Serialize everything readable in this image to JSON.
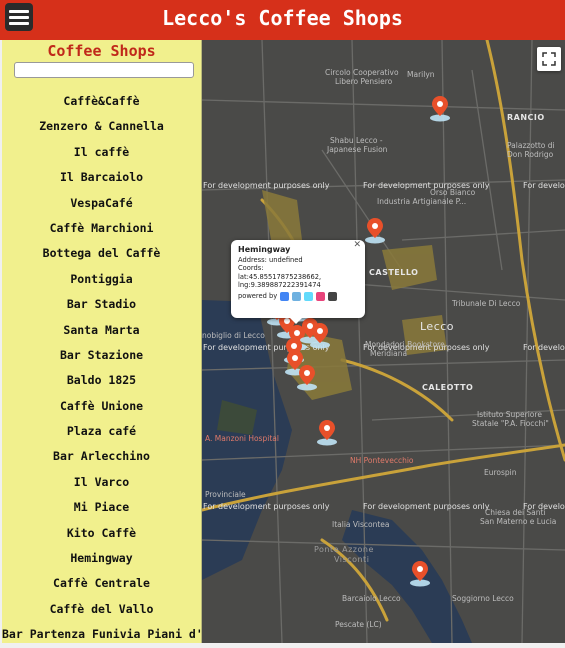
{
  "header": {
    "title": "Lecco's Coffee Shops"
  },
  "sidebar": {
    "heading": "Coffee Shops",
    "search": {
      "value": "",
      "placeholder": ""
    },
    "shops": [
      "Caffè&Caffè",
      "Zenzero & Cannella",
      "Il caffè",
      "Il Barcaiolo",
      "VespaCafé",
      "Caffè Marchioni",
      "Bottega del Caffè",
      "Pontiggia",
      "Bar Stadio",
      "Santa Marta",
      "Bar Stazione",
      "Baldo 1825",
      "Caffè Unione",
      "Plaza café",
      "Bar Arlecchino",
      "Il Varco",
      "Mi Piace",
      "Kito Caffè",
      "Hemingway",
      "Caffè Centrale",
      "Caffè del Vallo",
      "Bar Partenza Funivia Piani d'Erna"
    ]
  },
  "map": {
    "watermark": "For development purposes only",
    "labels": {
      "circolo": "Circolo Cooperativo",
      "circolo2": "Libero Pensiero",
      "marilyn": "Marilyn",
      "rancio": "RANCIO",
      "shabu": "Shabu Lecco -",
      "shabu2": "Japanese Fusion",
      "palazzotto": "Palazzotto di",
      "palazzotto2": "Don Rodrigo",
      "orso": "Orso Bianco",
      "orso2": "Industria Artigianale P...",
      "castello": "CASTELLO",
      "lecco": "Lecco",
      "tribunale": "Tribunale Di Lecco",
      "mondadori": "Mondadori Bookstore",
      "meridiana": "Meridiana",
      "caleotto": "CALEOTTO",
      "istituto": "Istituto Superiore",
      "istituto2": "Statale \"P.A. Fiocchi\"",
      "manzoni": "A. Manzoni Hospital",
      "nh": "NH Pontevecchio",
      "eurospin": "Eurospin",
      "provinciale": "Provinciale",
      "visconte": "Italia Viscontea",
      "ponte": "Ponte Azzone",
      "ponte2": "Visconti",
      "chiesa": "Chiesa dei Santi",
      "chiesa2": "San Materno e Lucia",
      "soggiorno": "Soggiorno Lecco",
      "barcaiolo": "Barcaiolo Lecco",
      "pescate": "Pescate (LC)",
      "nobiglio": "nobiglio di Lecco"
    },
    "colors": {
      "pin": "#e8502a",
      "road_major": "#c9a23a",
      "road": "#6b6b68",
      "water": "#2b3c55"
    },
    "popup": {
      "name": "Hemingway",
      "address": "Address: undefined",
      "coords_label": "Coords:",
      "lat": "lat:45.85517875238662,",
      "lng": "lng:9.389887222391474",
      "powered": "powered by"
    }
  }
}
